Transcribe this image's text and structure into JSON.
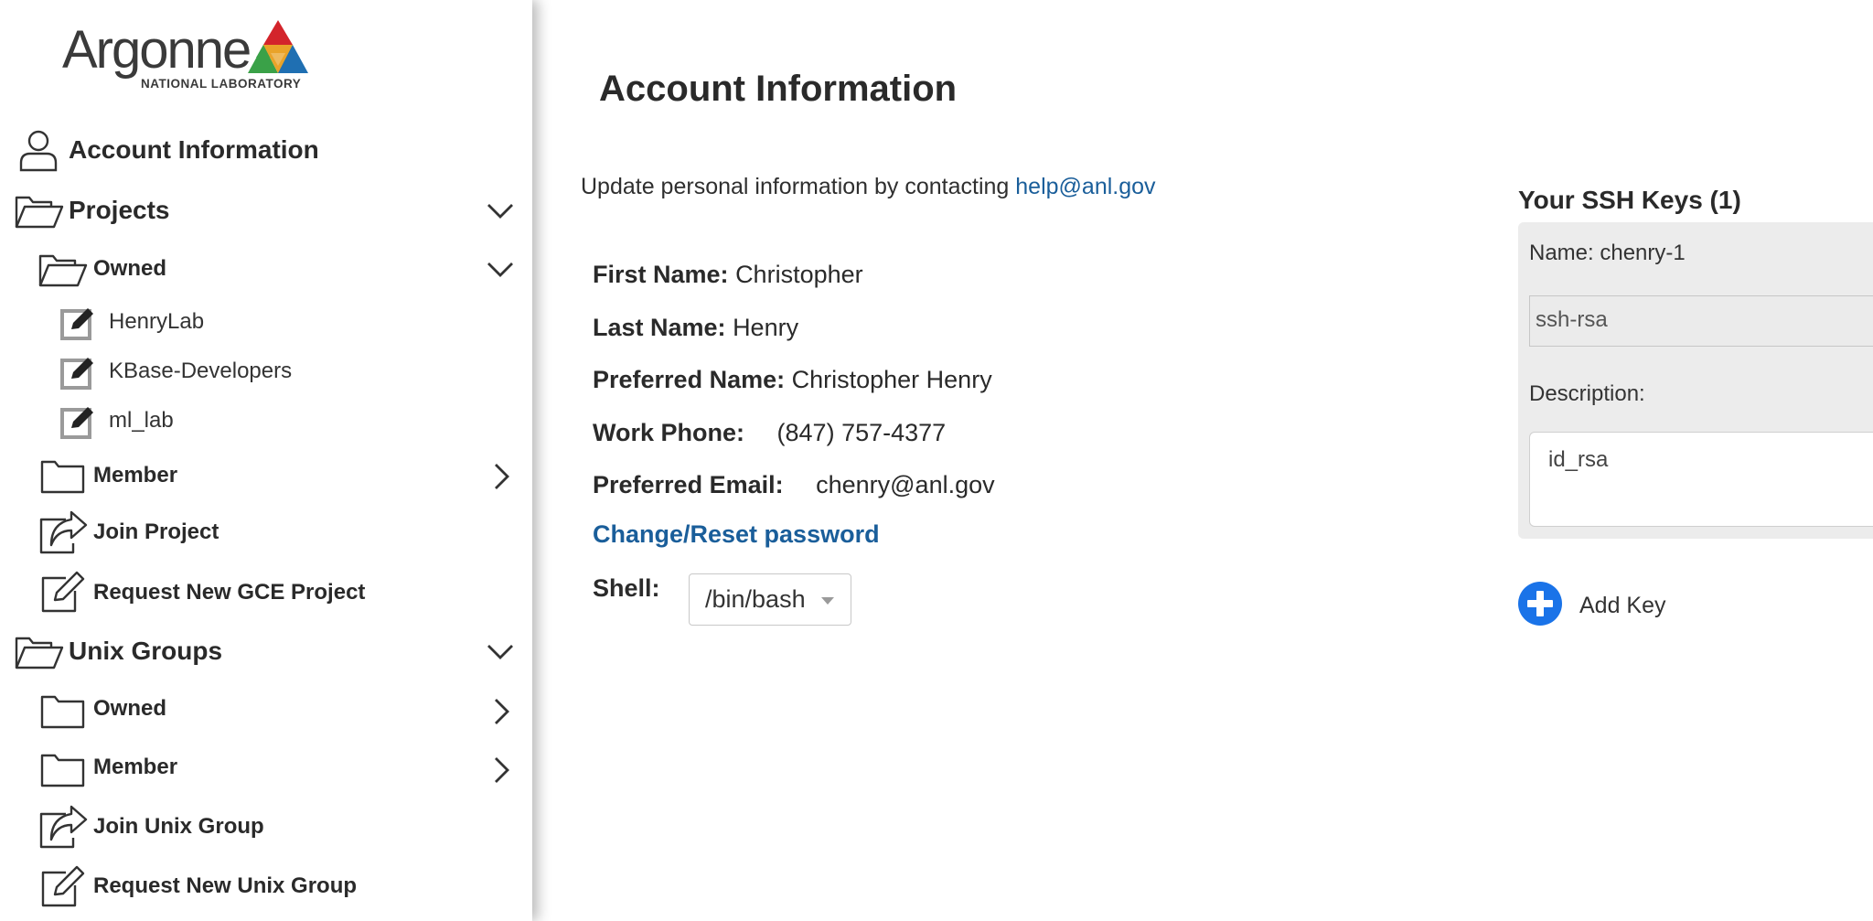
{
  "brand": {
    "logo_word": "Argonne",
    "logo_sub": "NATIONAL LABORATORY",
    "colors": {
      "blue": "#1f6fb2",
      "red": "#d3242b",
      "green": "#3aa148",
      "link": "#1a5e9a",
      "add_button": "#1a73e8"
    }
  },
  "sidebar": {
    "account_information": {
      "label": "Account Information",
      "icon": "user-icon"
    },
    "projects": {
      "label": "Projects",
      "icon": "folder-open-icon",
      "expanded": true,
      "owned": {
        "label": "Owned",
        "icon": "folder-open-icon",
        "expanded": true,
        "items": [
          {
            "label": "HenryLab",
            "icon": "edit-icon"
          },
          {
            "label": "KBase-Developers",
            "icon": "edit-icon"
          },
          {
            "label": "ml_lab",
            "icon": "edit-icon"
          }
        ]
      },
      "member": {
        "label": "Member",
        "icon": "folder-icon",
        "expanded": false
      },
      "join": {
        "label": "Join Project",
        "icon": "share-icon"
      },
      "request": {
        "label": "Request New GCE Project",
        "icon": "edit-icon"
      }
    },
    "unix_groups": {
      "label": "Unix Groups",
      "icon": "folder-open-icon",
      "expanded": true,
      "owned": {
        "label": "Owned",
        "icon": "folder-icon",
        "expanded": false
      },
      "member": {
        "label": "Member",
        "icon": "folder-icon",
        "expanded": false
      },
      "join": {
        "label": "Join Unix Group",
        "icon": "share-icon"
      },
      "request": {
        "label": "Request New Unix Group",
        "icon": "edit-icon"
      }
    }
  },
  "main": {
    "title": "Account Information",
    "intro_text": "Update personal information by contacting ",
    "intro_link": "help@anl.gov",
    "fields": {
      "first_name": {
        "label": "First Name:",
        "value": "Christopher"
      },
      "last_name": {
        "label": "Last Name:",
        "value": "Henry"
      },
      "preferred_name": {
        "label": "Preferred Name:",
        "value": "Christopher Henry"
      },
      "work_phone": {
        "label": "Work Phone:",
        "value": "(847) 757-4377"
      },
      "preferred_email": {
        "label": "Preferred Email:",
        "value": "chenry@anl.gov"
      }
    },
    "change_password": "Change/Reset password",
    "shell": {
      "label": "Shell:",
      "value": "/bin/bash"
    }
  },
  "ssh": {
    "title": "Your SSH Keys (1)",
    "key": {
      "name": "Name: chenry-1",
      "type": "ssh-rsa",
      "description_label": "Description:",
      "description": "id_rsa"
    },
    "add_key": "Add Key"
  }
}
